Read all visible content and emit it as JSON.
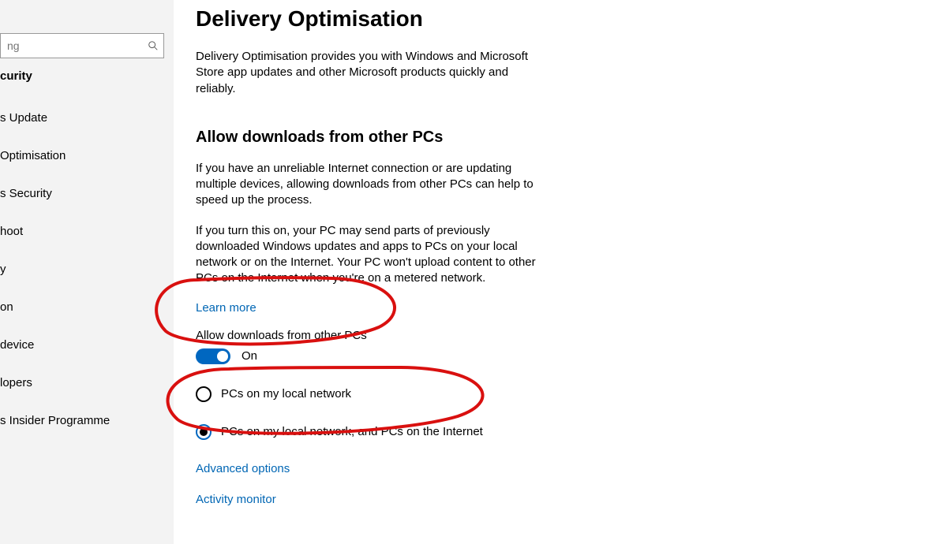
{
  "sidebar": {
    "search_placeholder": "ng",
    "heading": "curity",
    "items": [
      "s Update",
      "Optimisation",
      "s Security",
      "hoot",
      "y",
      "on",
      "device",
      "lopers",
      "s Insider Programme"
    ]
  },
  "page": {
    "title": "Delivery Optimisation",
    "intro": "Delivery Optimisation provides you with Windows and Microsoft Store app updates and other Microsoft products quickly and reliably.",
    "section_heading": "Allow downloads from other PCs",
    "para1": "If you have an unreliable Internet connection or are updating multiple devices, allowing downloads from other PCs can help to speed up the process.",
    "para2": "If you turn this on, your PC may send parts of previously downloaded Windows updates and apps to PCs on your local network or on the Internet. Your PC won't upload content to other PCs on the Internet when you're on a metered network.",
    "learn_more": "Learn more",
    "toggle_caption": "Allow downloads from other PCs",
    "toggle_state": "On",
    "radio1": "PCs on my local network",
    "radio2": "PCs on my local network, and PCs on the Internet",
    "advanced_options": "Advanced options",
    "activity_monitor": "Activity monitor"
  }
}
